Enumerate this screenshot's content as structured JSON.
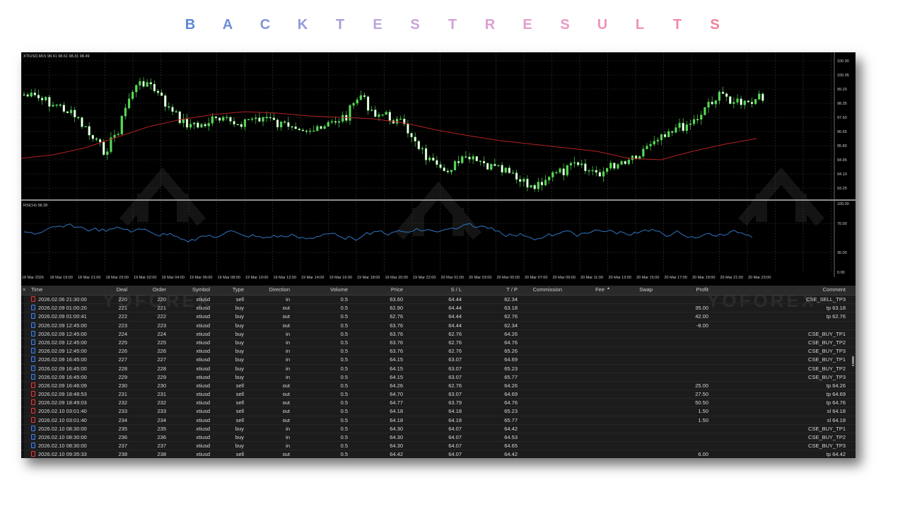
{
  "title": {
    "letters": [
      "B",
      "A",
      "C",
      "K",
      "T",
      "E",
      "S",
      "T",
      "R",
      "E",
      "S",
      "U",
      "L",
      "T",
      "S"
    ],
    "colors": [
      "#5b88d4",
      "#6f8ed6",
      "#8294d8",
      "#9599d9",
      "#a89fda",
      "#bba5dc",
      "#c9a4da",
      "#d3a2d6",
      "#dca0d0",
      "#e39ecb",
      "#e89bc4",
      "#ec96bc",
      "#ef91b2",
      "#f08aa6",
      "#f0829a"
    ]
  },
  "chart": {
    "symbol_info": "XTIUSD,M15  98.41 98.61 98.31 98.49",
    "price_ticks": [
      "100.90",
      "100.05",
      "99.20",
      "98.35",
      "97.50",
      "96.65",
      "95.80",
      "94.95",
      "94.10",
      "93.25"
    ],
    "rsi_label": "RSI(14) 58.28",
    "rsi_ticks": [
      "100.00",
      "70.00",
      "30.00",
      "0.00"
    ],
    "time_labels": [
      "18 Mar 2026",
      "18 Mar 19:00",
      "18 Mar 21:00",
      "18 Mar 23:00",
      "19 Mar 02:00",
      "19 Mar 04:00",
      "19 Mar 06:00",
      "19 Mar 08:00",
      "19 Mar 10:00",
      "19 Mar 12:00",
      "19 Mar 14:00",
      "19 Mar 16:00",
      "19 Mar 18:00",
      "19 Mar 20:00",
      "19 Mar 22:00",
      "20 Mar 01:00",
      "20 Mar 03:00",
      "20 Mar 05:00",
      "20 Mar 07:00",
      "20 Mar 09:00",
      "20 Mar 11:00",
      "20 Mar 13:00",
      "20 Mar 15:00",
      "20 Mar 17:00",
      "20 Mar 19:00",
      "20 Mar 21:00",
      "20 Mar 23:00"
    ],
    "colors": {
      "bull": "#56d856",
      "bear": "#ffffff",
      "wick": "#56d856",
      "ma": "#b22222",
      "rsi": "#2f74c0",
      "grid": "#3a3a3a",
      "axis": "#cfcfcf"
    },
    "watermark": "YOFOREX"
  },
  "table": {
    "close_icon": "×",
    "columns": [
      "Time",
      "Deal",
      "Order",
      "Symbol",
      "Type",
      "Direction",
      "Volume",
      "Price",
      "S / L",
      "T / P",
      "Commission",
      "Fee",
      "Swap",
      "Profit",
      "Comment"
    ],
    "fee_sort": "▲",
    "rows": [
      {
        "time": "2026.02.06 21:30:00",
        "deal": "220",
        "order": "220",
        "symbol": "xtiusd",
        "type": "sell",
        "direction": "in",
        "volume": "0.5",
        "price": "63.60",
        "sl": "64.44",
        "tp": "62.34",
        "profit": "",
        "comment": "CSE_SELL_TP3"
      },
      {
        "time": "2026.02.09 01:00:20",
        "deal": "221",
        "order": "221",
        "symbol": "xtiusd",
        "type": "buy",
        "direction": "out",
        "volume": "0.5",
        "price": "62.90",
        "sl": "64.44",
        "tp": "63.18",
        "profit": "35.00",
        "comment": "tp 63.18"
      },
      {
        "time": "2026.02.09 01:00:41",
        "deal": "222",
        "order": "222",
        "symbol": "xtiusd",
        "type": "buy",
        "direction": "out",
        "volume": "0.5",
        "price": "62.76",
        "sl": "64.44",
        "tp": "62.76",
        "profit": "42.00",
        "comment": "tp 62.76"
      },
      {
        "time": "2026.02.09 12:45:00",
        "deal": "223",
        "order": "223",
        "symbol": "xtiusd",
        "type": "buy",
        "direction": "out",
        "volume": "0.5",
        "price": "63.76",
        "sl": "64.44",
        "tp": "62.34",
        "profit": "-8.00",
        "comment": ""
      },
      {
        "time": "2026.02.09 12:45:00",
        "deal": "224",
        "order": "224",
        "symbol": "xtiusd",
        "type": "buy",
        "direction": "in",
        "volume": "0.5",
        "price": "63.76",
        "sl": "62.76",
        "tp": "64.26",
        "profit": "",
        "comment": "CSE_BUY_TP1"
      },
      {
        "time": "2026.02.09 12:45:00",
        "deal": "225",
        "order": "225",
        "symbol": "xtiusd",
        "type": "buy",
        "direction": "in",
        "volume": "0.5",
        "price": "63.76",
        "sl": "62.76",
        "tp": "64.76",
        "profit": "",
        "comment": "CSE_BUY_TP2"
      },
      {
        "time": "2026.02.09 12:45:00",
        "deal": "226",
        "order": "226",
        "symbol": "xtiusd",
        "type": "buy",
        "direction": "in",
        "volume": "0.5",
        "price": "63.76",
        "sl": "62.76",
        "tp": "65.26",
        "profit": "",
        "comment": "CSE_BUY_TP3"
      },
      {
        "time": "2026.02.09 16:45:00",
        "deal": "227",
        "order": "227",
        "symbol": "xtiusd",
        "type": "buy",
        "direction": "in",
        "volume": "0.5",
        "price": "64.15",
        "sl": "63.07",
        "tp": "64.69",
        "profit": "",
        "comment": "CSE_BUY_TP1"
      },
      {
        "time": "2026.02.09 16:45:00",
        "deal": "228",
        "order": "228",
        "symbol": "xtiusd",
        "type": "buy",
        "direction": "in",
        "volume": "0.5",
        "price": "64.15",
        "sl": "63.07",
        "tp": "65.23",
        "profit": "",
        "comment": "CSE_BUY_TP2"
      },
      {
        "time": "2026.02.09 16:45:00",
        "deal": "229",
        "order": "229",
        "symbol": "xtiusd",
        "type": "buy",
        "direction": "in",
        "volume": "0.5",
        "price": "64.15",
        "sl": "63.07",
        "tp": "65.77",
        "profit": "",
        "comment": "CSE_BUY_TP3"
      },
      {
        "time": "2026.02.09 16:46:09",
        "deal": "230",
        "order": "230",
        "symbol": "xtiusd",
        "type": "sell",
        "direction": "out",
        "volume": "0.5",
        "price": "64.26",
        "sl": "62.76",
        "tp": "64.26",
        "profit": "25.00",
        "comment": "tp 64.26"
      },
      {
        "time": "2026.02.09 18:48:53",
        "deal": "231",
        "order": "231",
        "symbol": "xtiusd",
        "type": "sell",
        "direction": "out",
        "volume": "0.5",
        "price": "64.70",
        "sl": "63.07",
        "tp": "64.69",
        "profit": "27.50",
        "comment": "tp 64.69"
      },
      {
        "time": "2026.02.09 18:49:03",
        "deal": "232",
        "order": "232",
        "symbol": "xtiusd",
        "type": "sell",
        "direction": "out",
        "volume": "0.5",
        "price": "64.77",
        "sl": "63.79",
        "tp": "64.76",
        "profit": "50.50",
        "comment": "tp 64.76"
      },
      {
        "time": "2026.02.10 03:01:40",
        "deal": "233",
        "order": "233",
        "symbol": "xtiusd",
        "type": "sell",
        "direction": "out",
        "volume": "0.5",
        "price": "64.18",
        "sl": "64.18",
        "tp": "65.23",
        "profit": "1.50",
        "comment": "sl 64.18"
      },
      {
        "time": "2026.02.10 03:01:40",
        "deal": "234",
        "order": "234",
        "symbol": "xtiusd",
        "type": "sell",
        "direction": "out",
        "volume": "0.5",
        "price": "64.18",
        "sl": "64.18",
        "tp": "65.77",
        "profit": "1.50",
        "comment": "sl 64.18"
      },
      {
        "time": "2026.02.10 08:30:00",
        "deal": "235",
        "order": "235",
        "symbol": "xtiusd",
        "type": "buy",
        "direction": "in",
        "volume": "0.5",
        "price": "64.30",
        "sl": "64.07",
        "tp": "64.42",
        "profit": "",
        "comment": "CSE_BUY_TP1"
      },
      {
        "time": "2026.02.10 08:30:00",
        "deal": "236",
        "order": "236",
        "symbol": "xtiusd",
        "type": "buy",
        "direction": "in",
        "volume": "0.5",
        "price": "64.30",
        "sl": "64.07",
        "tp": "64.53",
        "profit": "",
        "comment": "CSE_BUY_TP2"
      },
      {
        "time": "2026.02.10 08:30:00",
        "deal": "237",
        "order": "237",
        "symbol": "xtiusd",
        "type": "buy",
        "direction": "in",
        "volume": "0.5",
        "price": "64.30",
        "sl": "64.07",
        "tp": "64.65",
        "profit": "",
        "comment": "CSE_BUY_TP3"
      },
      {
        "time": "2026.02.10 09:35:33",
        "deal": "238",
        "order": "238",
        "symbol": "xtiusd",
        "type": "sell",
        "direction": "out",
        "volume": "0.5",
        "price": "64.42",
        "sl": "64.07",
        "tp": "64.42",
        "profit": "6.00",
        "comment": "tp 64.42"
      }
    ]
  }
}
